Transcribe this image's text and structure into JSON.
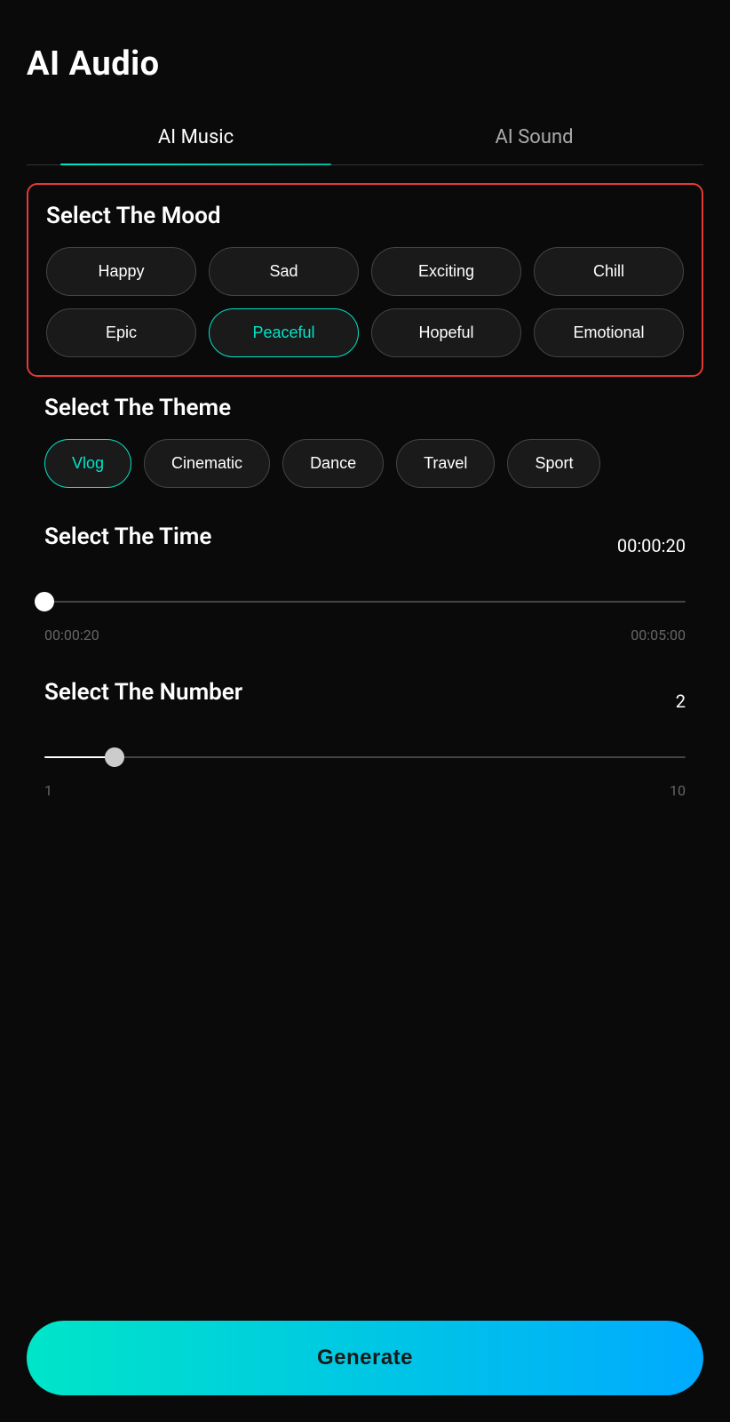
{
  "page": {
    "title": "AI Audio"
  },
  "tabs": [
    {
      "id": "ai-music",
      "label": "AI Music",
      "active": true
    },
    {
      "id": "ai-sound",
      "label": "AI Sound",
      "active": false
    }
  ],
  "mood_section": {
    "title": "Select The Mood",
    "moods": [
      {
        "id": "happy",
        "label": "Happy",
        "selected": false
      },
      {
        "id": "sad",
        "label": "Sad",
        "selected": false
      },
      {
        "id": "exciting",
        "label": "Exciting",
        "selected": false
      },
      {
        "id": "chill",
        "label": "Chill",
        "selected": false
      },
      {
        "id": "epic",
        "label": "Epic",
        "selected": false
      },
      {
        "id": "peaceful",
        "label": "Peaceful",
        "selected": true
      },
      {
        "id": "hopeful",
        "label": "Hopeful",
        "selected": false
      },
      {
        "id": "emotional",
        "label": "Emotional",
        "selected": false
      }
    ]
  },
  "theme_section": {
    "title": "Select The Theme",
    "themes": [
      {
        "id": "vlog",
        "label": "Vlog",
        "selected": true
      },
      {
        "id": "cinematic",
        "label": "Cinematic",
        "selected": false
      },
      {
        "id": "dance",
        "label": "Dance",
        "selected": false
      },
      {
        "id": "travel",
        "label": "Travel",
        "selected": false
      },
      {
        "id": "sport",
        "label": "Sport",
        "selected": false
      }
    ]
  },
  "time_section": {
    "title": "Select The Time",
    "current_value": "00:00:20",
    "min_label": "00:00:20",
    "max_label": "00:05:00",
    "thumb_position_percent": 0
  },
  "number_section": {
    "title": "Select The Number",
    "current_value": "2",
    "min_label": "1",
    "max_label": "10",
    "thumb_position_percent": 11
  },
  "generate_button": {
    "label": "Generate"
  },
  "colors": {
    "accent": "#00e5c8",
    "accent_secondary": "#00aaff",
    "selected_border": "#00e5c8",
    "selected_text": "#00e5c8",
    "mood_border_highlight": "#e53935"
  }
}
